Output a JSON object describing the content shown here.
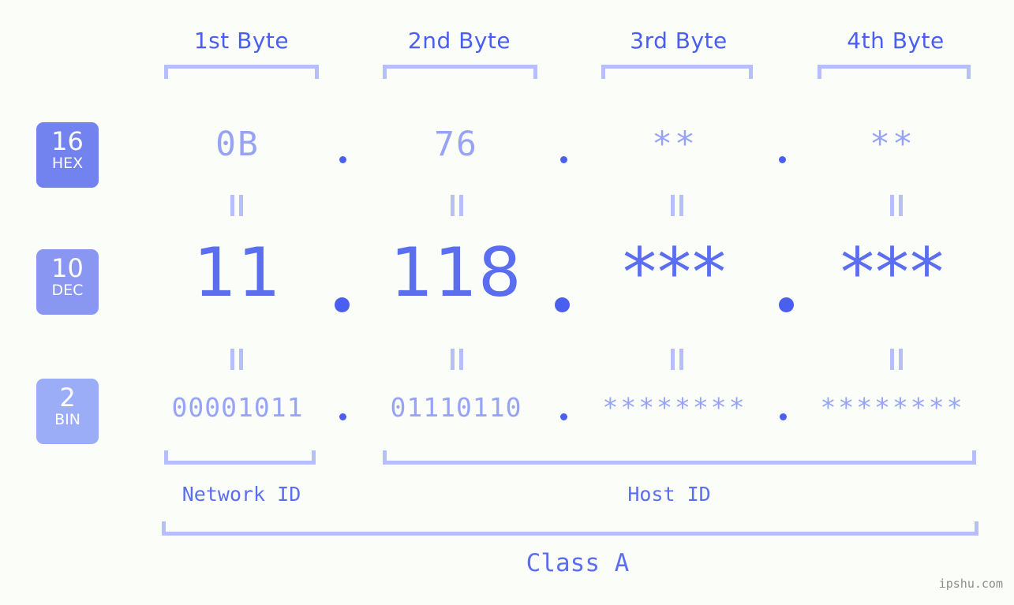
{
  "meta": {
    "background_color": "#fbfdf9",
    "accent_color": "#5b6ef0",
    "muted_color": "#97a4f5",
    "bracket_color": "#b7bffa"
  },
  "byte_headers": [
    {
      "label": "1st Byte"
    },
    {
      "label": "2nd Byte"
    },
    {
      "label": "3rd Byte"
    },
    {
      "label": "4th Byte"
    }
  ],
  "rows": [
    {
      "badge": {
        "number": "16",
        "unit": "HEX"
      },
      "values": [
        "0B",
        "76",
        "**",
        "**"
      ],
      "separators": [
        ".",
        ".",
        "."
      ]
    },
    {
      "badge": {
        "number": "10",
        "unit": "DEC"
      },
      "values": [
        "11",
        "118",
        "***",
        "***"
      ],
      "separators": [
        ".",
        ".",
        "."
      ]
    },
    {
      "badge": {
        "number": "2",
        "unit": "BIN"
      },
      "values": [
        "00001011",
        "01110110",
        "********",
        "********"
      ],
      "separators": [
        ".",
        ".",
        "."
      ]
    }
  ],
  "equal_marks": {
    "glyph": "||",
    "count_per_row": 4
  },
  "id_sections": [
    {
      "label": "Network ID"
    },
    {
      "label": "Host ID"
    }
  ],
  "class_section": {
    "label": "Class A"
  },
  "watermark": {
    "text": "ipshu.com"
  }
}
